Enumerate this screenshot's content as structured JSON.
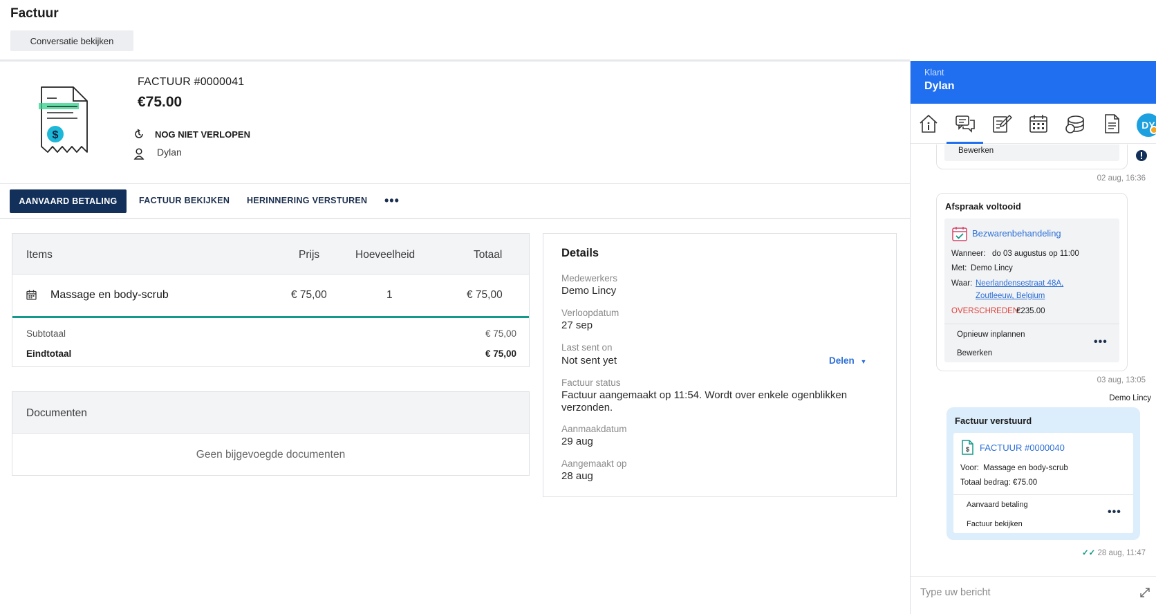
{
  "header": {
    "title": "Factuur",
    "conversation_button": "Conversatie bekijken"
  },
  "invoice": {
    "number": "FACTUUR #0000041",
    "amount": "€75.00",
    "status": "NOG NIET VERLOPEN",
    "customer": "Dylan"
  },
  "actions": {
    "accept": "AANVAARD BETALING",
    "view": "FACTUUR BEKIJKEN",
    "remind": "HERINNERING VERSTUREN",
    "more": "•••"
  },
  "items_table": {
    "headers": {
      "items": "Items",
      "price": "Prijs",
      "qty": "Hoeveelheid",
      "total": "Totaal"
    },
    "rows": [
      {
        "name": "Massage en body-scrub",
        "price": "€ 75,00",
        "qty": "1",
        "total": "€ 75,00"
      }
    ],
    "subtotal_label": "Subtotaal",
    "subtotal_value": "€ 75,00",
    "grand_label": "Eindtotaal",
    "grand_value": "€ 75,00"
  },
  "documents": {
    "title": "Documenten",
    "empty": "Geen bijgevoegde documenten"
  },
  "details": {
    "title": "Details",
    "staff_label": "Medewerkers",
    "staff_value": "Demo Lincy",
    "due_label": "Verloopdatum",
    "due_value": "27 sep",
    "sent_label": "Last sent on",
    "sent_value": "Not sent yet",
    "share": "Delen",
    "status_label": "Factuur status",
    "status_value": "Factuur aangemaakt op 11:54. Wordt over enkele ogenblikken verzonden.",
    "created_date_label": "Aanmaakdatum",
    "created_date_value": "29 aug",
    "created_on_label": "Aangemaakt op",
    "created_on_value": "28 aug"
  },
  "panel": {
    "label": "Klant",
    "name": "Dylan",
    "avatar": "DY",
    "tabs": [
      "home-info-icon",
      "conversation-icon",
      "notes-icon",
      "calendar-icon",
      "payments-icon",
      "document-icon"
    ],
    "composer_placeholder": "Type uw bericht"
  },
  "chat": {
    "msg1": {
      "action": "Bewerken",
      "time": "02 aug, 16:36"
    },
    "msg2": {
      "title": "Afspraak voltooid",
      "service": "Bezwarenbehandeling",
      "when_label": "Wanneer:",
      "when_value": "do 03 augustus op 11:00",
      "with_label": "Met:",
      "with_value": "Demo Lincy",
      "where_label": "Waar:",
      "where_line1": "Neerlandensestraat 48A,",
      "where_line2": "Zoutleeuw, Belgium",
      "overdue_label": "OVERSCHREDEN:",
      "overdue_value": "€235.00",
      "action1": "Opnieuw inplannen",
      "action2": "Bewerken",
      "time": "03 aug, 13:05"
    },
    "msg3": {
      "sender": "Demo Lincy",
      "title": "Factuur verstuurd",
      "invoice": "FACTUUR #0000040",
      "for_label": "Voor:",
      "for_value": "Massage en body-scrub",
      "total_label": "Totaal bedrag:",
      "total_value": "€75.00",
      "action1": "Aanvaard betaling",
      "action2": "Factuur bekijken",
      "time": "28 aug, 11:47"
    }
  },
  "colors": {
    "primary_dark": "#12305a",
    "panel_blue": "#1f6ff0",
    "teal": "#14998a",
    "link_blue": "#2d6fd7",
    "overdue_red": "#e0413a"
  }
}
